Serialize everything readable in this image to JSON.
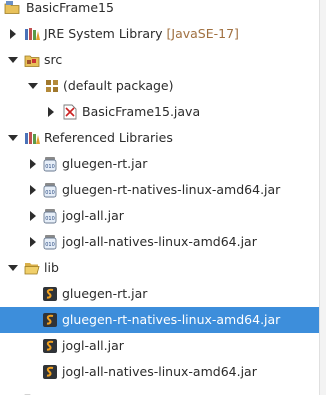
{
  "tree": {
    "project": {
      "label": "BasicFrame15"
    },
    "jre": {
      "label": "JRE System Library",
      "decoration": "[JavaSE-17]"
    },
    "src": {
      "label": "src"
    },
    "default_package": {
      "label": "(default package)"
    },
    "java_file": {
      "label": "BasicFrame15.java"
    },
    "referenced_libraries": {
      "label": "Referenced Libraries"
    },
    "ref_jars": [
      {
        "label": "gluegen-rt.jar"
      },
      {
        "label": "gluegen-rt-natives-linux-amd64.jar"
      },
      {
        "label": "jogl-all.jar"
      },
      {
        "label": "jogl-all-natives-linux-amd64.jar"
      }
    ],
    "lib": {
      "label": "lib"
    },
    "lib_jars": [
      {
        "label": "gluegen-rt.jar"
      },
      {
        "label": "gluegen-rt-natives-linux-amd64.jar",
        "selected": true
      },
      {
        "label": "jogl-all.jar"
      },
      {
        "label": "jogl-all-natives-linux-amd64.jar"
      }
    ]
  },
  "colors": {
    "selection": "#3d8edb",
    "decoration": "#a07040"
  }
}
